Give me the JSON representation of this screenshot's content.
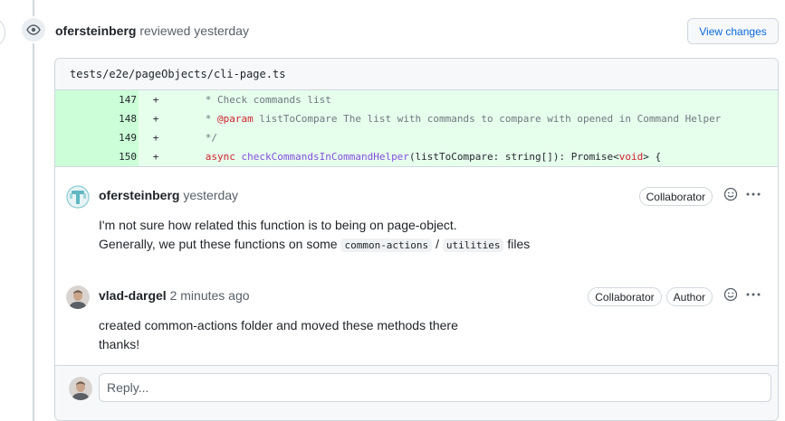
{
  "review": {
    "author": "ofersteinberg",
    "action": "reviewed yesterday",
    "view_changes_label": "View changes"
  },
  "file": {
    "path": "tests/e2e/pageObjects/cli-page.ts"
  },
  "diff": {
    "lines": [
      {
        "num": "147",
        "sign": "+",
        "indent": "      ",
        "parts": [
          {
            "t": "* Check commands list",
            "c": "comment"
          }
        ]
      },
      {
        "num": "148",
        "sign": "+",
        "indent": "      ",
        "parts": [
          {
            "t": "* ",
            "c": "comment"
          },
          {
            "t": "@param",
            "c": "key"
          },
          {
            "t": " listToCompare The list with commands to compare with opened in Command Helper",
            "c": "comment"
          }
        ]
      },
      {
        "num": "149",
        "sign": "+",
        "indent": "      ",
        "parts": [
          {
            "t": "*/",
            "c": "comment"
          }
        ]
      },
      {
        "num": "150",
        "sign": "+",
        "indent": "      ",
        "parts": [
          {
            "t": "async",
            "c": "key"
          },
          {
            "t": " ",
            "c": ""
          },
          {
            "t": "checkCommandsInCommandHelper",
            "c": "fn"
          },
          {
            "t": "(listToCompare: string[]): Promise<",
            "c": ""
          },
          {
            "t": "void",
            "c": "key"
          },
          {
            "t": "> {",
            "c": ""
          }
        ]
      }
    ]
  },
  "comments": [
    {
      "author": "ofersteinberg",
      "time": "yesterday",
      "badges": [
        "Collaborator"
      ],
      "line1": "I'm not sure how related this function is to being on page-object.",
      "line2_prefix": "Generally, we put these functions on some",
      "code1": "common-actions",
      "separator": "/",
      "code2": "utilities",
      "line2_suffix": "files"
    },
    {
      "author": "vlad-dargel",
      "time": "2 minutes ago",
      "badges": [
        "Collaborator",
        "Author"
      ],
      "line1": "created common-actions folder and moved these methods there",
      "line2": "thanks!"
    }
  ],
  "reply": {
    "placeholder": "Reply..."
  },
  "colors": {
    "link": "#0969da",
    "diff_add_bg": "#e6ffec",
    "diff_add_num_bg": "#ccffd8",
    "border": "#d0d7de"
  },
  "icons": [
    "eye-icon",
    "smiley-icon",
    "kebab-icon"
  ]
}
